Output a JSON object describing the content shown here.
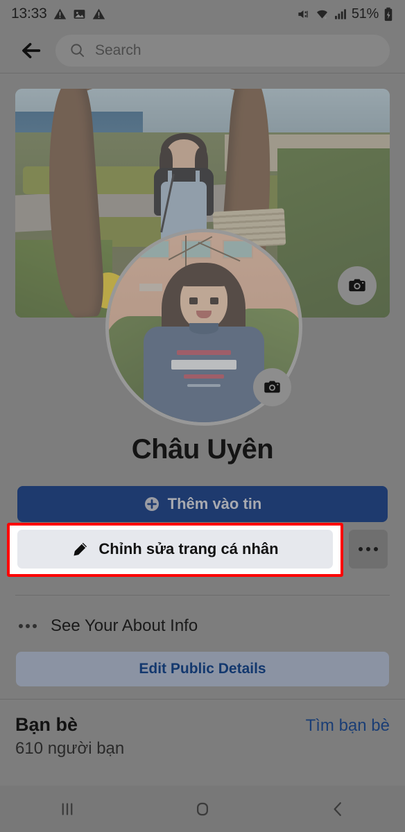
{
  "status_bar": {
    "clock": "13:33",
    "battery_percent": "51%",
    "left_icons": [
      "warning-triangle-icon",
      "image-icon",
      "warning-triangle-icon"
    ],
    "right_icons": [
      "mute-icon",
      "wifi-icon",
      "signal-bars-icon",
      "battery-charging-icon"
    ]
  },
  "header": {
    "back_icon": "back-arrow-icon",
    "search_icon": "search-icon",
    "search_placeholder": "Search",
    "search_value": ""
  },
  "cover": {
    "camera_icon": "camera-icon"
  },
  "avatar": {
    "camera_icon": "camera-icon"
  },
  "profile": {
    "name": "Châu Uyên"
  },
  "actions": {
    "add_story_label": "Thêm vào tin",
    "add_story_icon": "plus-circle-icon",
    "add_story_color": "#1e3a6e",
    "edit_profile_label": "Chỉnh sửa trang cá nhân",
    "edit_profile_icon": "pencil-icon",
    "more_icon": "ellipsis-icon",
    "highlight_color": "#ff0000"
  },
  "about": {
    "see_about_icon": "ellipsis-icon",
    "see_about_label": "See Your About Info",
    "edit_public_label": "Edit Public Details",
    "edit_public_text_color": "#13386e"
  },
  "friends": {
    "title": "Bạn bè",
    "count_text": "610 người bạn",
    "find_link": "Tìm bạn bè",
    "find_link_color": "#1b3e75"
  },
  "navbar": {
    "recents_icon": "recents-icon",
    "home_icon": "home-icon",
    "back_icon": "back-chevron-icon"
  }
}
